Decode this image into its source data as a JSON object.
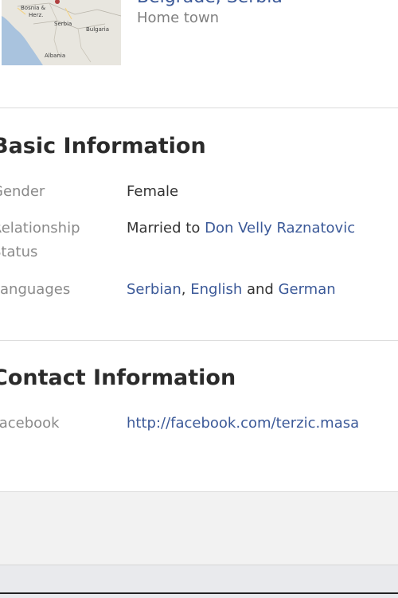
{
  "hometown": {
    "map_labels": [
      "Bosnia &",
      "Herz.",
      "Serbia",
      "Bulgaria",
      "Albania"
    ],
    "city_link": "Belgrade, Serbia",
    "subtitle": "Home town"
  },
  "basic_info": {
    "title": "Basic Information",
    "gender": {
      "label": "Gender",
      "value": "Female"
    },
    "relationship": {
      "label_line1": "Relationship",
      "label_line2": "Status",
      "prefix": "Married to",
      "partner": "Don Velly Raznatovic"
    },
    "languages": {
      "label": "Languages",
      "items": [
        "Serbian",
        "English",
        "German"
      ],
      "separator": ",",
      "conjunction": "and"
    }
  },
  "contact_info": {
    "title": "Contact Information",
    "facebook": {
      "label": "Facebook",
      "url": "http://facebook.com/terzic.masa"
    }
  },
  "colors": {
    "link": "#3b5998",
    "label": "#8a8a8a",
    "divider": "#dcdcdc"
  }
}
